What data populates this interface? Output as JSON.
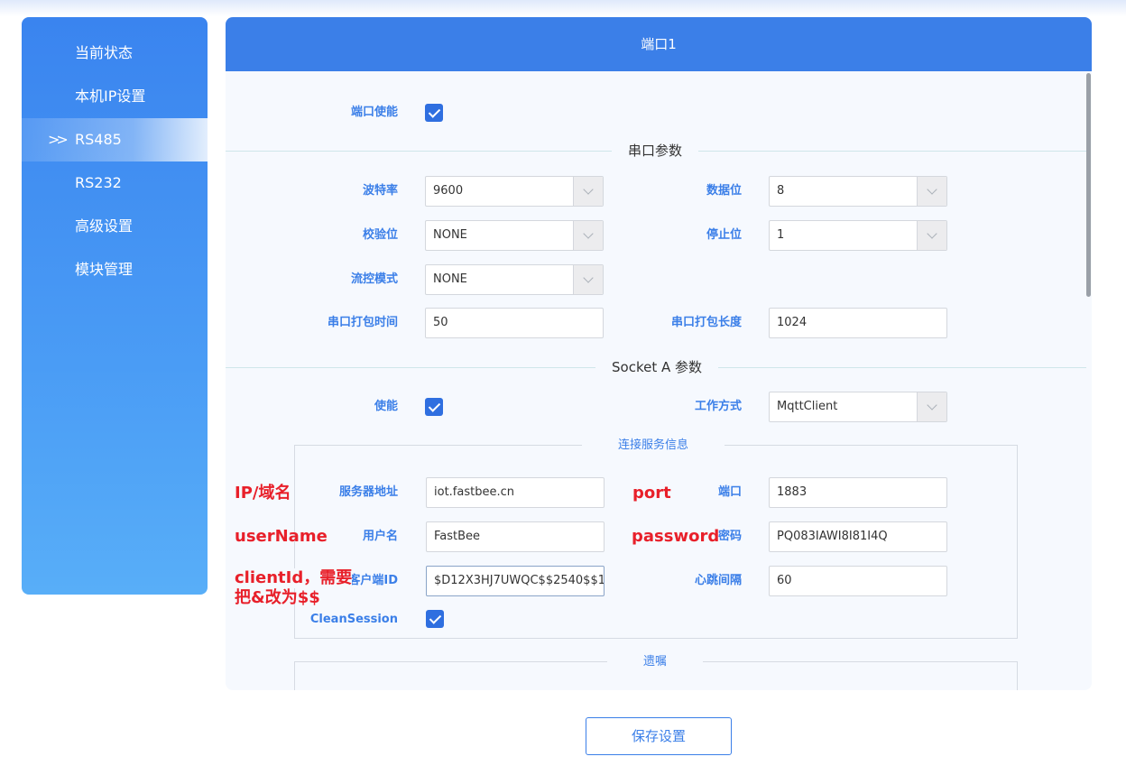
{
  "sidebar": {
    "items": [
      {
        "label": "当前状态"
      },
      {
        "label": "本机IP设置"
      },
      {
        "label": "RS485",
        "active": true
      },
      {
        "label": "RS232"
      },
      {
        "label": "高级设置"
      },
      {
        "label": "模块管理"
      }
    ],
    "active_indicator": "»"
  },
  "panel": {
    "title": "端口1",
    "port_enable": {
      "label": "端口使能",
      "checked": true
    },
    "serial_section": {
      "title": "串口参数",
      "baud": {
        "label": "波特率",
        "value": "9600"
      },
      "data_bits": {
        "label": "数据位",
        "value": "8"
      },
      "parity": {
        "label": "校验位",
        "value": "NONE"
      },
      "stop_bits": {
        "label": "停止位",
        "value": "1"
      },
      "flow": {
        "label": "流控模式",
        "value": "NONE"
      },
      "pack_time": {
        "label": "串口打包时间",
        "value": "50"
      },
      "pack_len": {
        "label": "串口打包长度",
        "value": "1024"
      }
    },
    "socket_section": {
      "title": "Socket A 参数",
      "enable": {
        "label": "使能",
        "checked": true
      },
      "mode": {
        "label": "工作方式",
        "value": "MqttClient"
      },
      "conn_title": "连接服务信息",
      "server": {
        "label": "服务器地址",
        "value": "iot.fastbee.cn"
      },
      "port": {
        "label": "端口",
        "value": "1883"
      },
      "username": {
        "label": "用户名",
        "value": "FastBee"
      },
      "password": {
        "label": "密码",
        "value": "PQ083IAWI8I81I4Q"
      },
      "client_id": {
        "label": "客户端ID",
        "value": "$D12X3HJ7UWQC$$2540$$1"
      },
      "heartbeat": {
        "label": "心跳间隔",
        "value": "60"
      },
      "clean_session": {
        "label": "CleanSession",
        "checked": true
      },
      "will_title": "遗嘱"
    }
  },
  "annotations": {
    "ip": "IP/域名",
    "port": "port",
    "username": "userName",
    "password": "password",
    "client_id_line1": "clientId，需要",
    "client_id_line2": "把&改为$$"
  },
  "save_button": "保存设置",
  "colors": {
    "primary": "#3b7fe8",
    "annotation": "#e8202a",
    "checkbox": "#2f6fe0"
  }
}
